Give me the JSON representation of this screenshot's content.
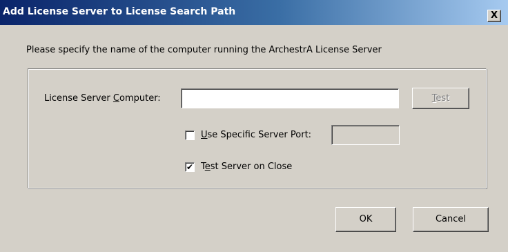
{
  "dialog": {
    "title": "Add License Server to License Search Path",
    "close_glyph": "X",
    "instruction": "Please specify the name of the computer running the ArchestrA License Server"
  },
  "computer_field": {
    "label_before": "License Server ",
    "label_accel": "C",
    "label_after": "omputer:",
    "value": ""
  },
  "test_button": {
    "accel": "T",
    "rest": "est",
    "enabled": false
  },
  "port_option": {
    "checked": false,
    "label_accel": "U",
    "label_rest": "se Specific Server Port:",
    "value": ""
  },
  "close_option": {
    "checked": true,
    "check_glyph": "✔",
    "label_first": "T",
    "label_accel": "e",
    "label_rest": "st Server on Close"
  },
  "buttons": {
    "ok": "OK",
    "cancel": "Cancel"
  }
}
